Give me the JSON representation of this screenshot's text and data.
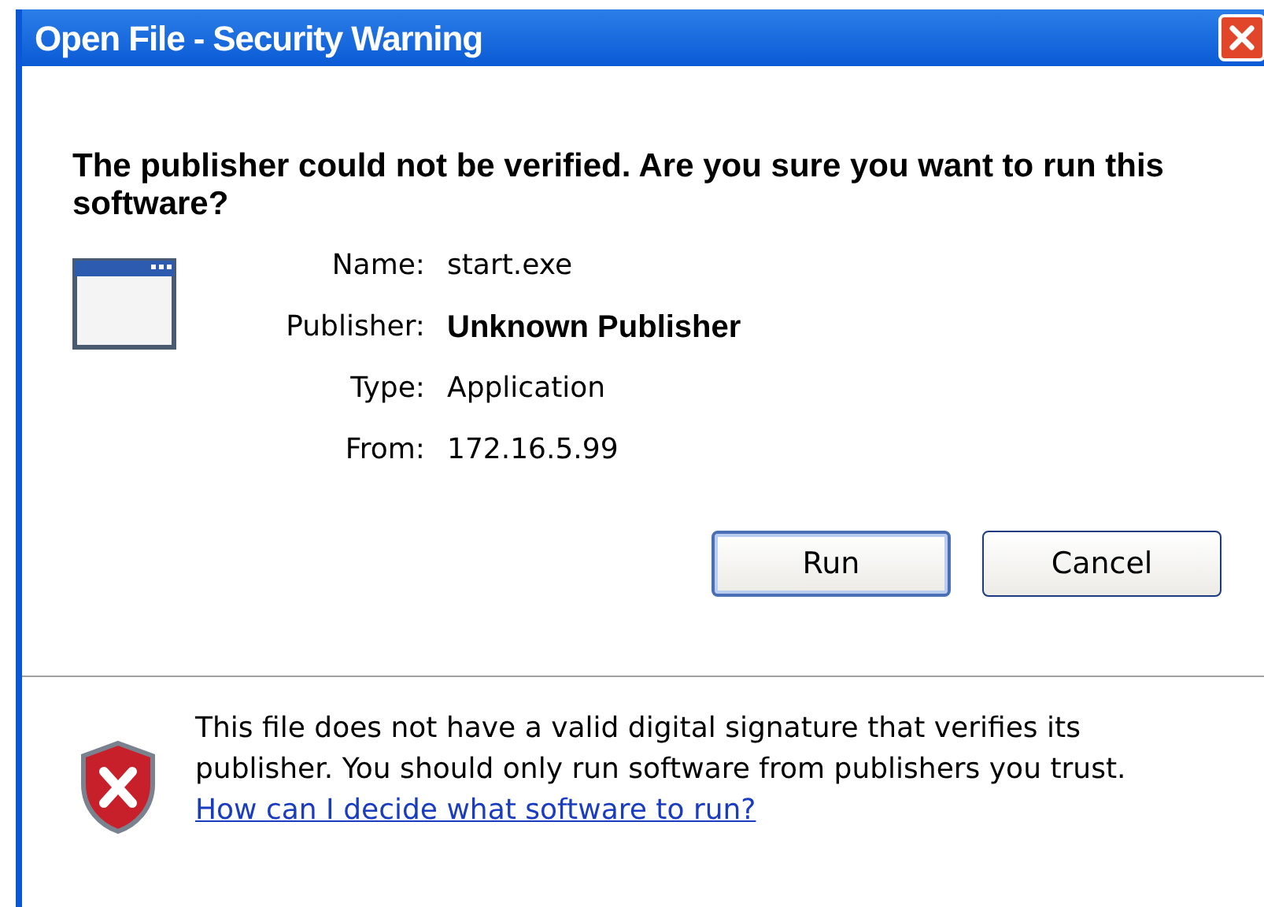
{
  "window": {
    "title": "Open File - Security Warning"
  },
  "heading": "The publisher could not be verified.  Are you sure you want to run this software?",
  "details": [
    {
      "label": "Name:",
      "value": "start.exe",
      "emphasis": false
    },
    {
      "label": "Publisher:",
      "value": "Unknown Publisher",
      "emphasis": true
    },
    {
      "label": "Type:",
      "value": "Application",
      "emphasis": false
    },
    {
      "label": "From:",
      "value": "172.16.5.99",
      "emphasis": false
    }
  ],
  "buttons": [
    {
      "label": "Run",
      "default": true
    },
    {
      "label": "Cancel",
      "default": false
    }
  ],
  "warning": {
    "text": "This file does not have a valid digital signature that verifies its publisher.  You should only run software from publishers you trust.",
    "link": "How can I decide what software to run?"
  }
}
